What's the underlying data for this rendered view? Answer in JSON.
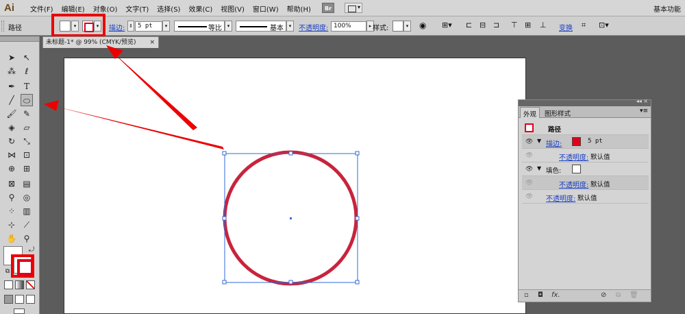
{
  "app": {
    "logo": "Ai",
    "menu": [
      "文件(F)",
      "编辑(E)",
      "对象(O)",
      "文字(T)",
      "选择(S)",
      "效果(C)",
      "视图(V)",
      "窗口(W)",
      "帮助(H)"
    ],
    "bridge_label": "Br",
    "workspace": "基本功能"
  },
  "control": {
    "selection_label": "路径",
    "stroke_label": "描边:",
    "stroke_weight": "5 pt",
    "profile_label": "等比",
    "brush_label": "基本",
    "opacity_label": "不透明度:",
    "opacity_value": "100%",
    "style_label": "样式:",
    "transform_label": "变换"
  },
  "document": {
    "tab_title": "未标题-1* @ 99% (CMYK/预览)",
    "close_glyph": "×"
  },
  "appearance_panel": {
    "tabs": [
      "外观",
      "图形样式"
    ],
    "header": "路径",
    "rows": [
      {
        "link": "描边:",
        "value": "5 pt"
      },
      {
        "link": "不透明度:",
        "value": "默认值"
      },
      {
        "label": "填色:"
      },
      {
        "link": "不透明度:",
        "value": "默认值"
      },
      {
        "link": "不透明度:",
        "value": "默认值"
      }
    ],
    "fx_label": "fx."
  },
  "colors": {
    "stroke": "#e0001a",
    "circle_stroke": "#c8243c",
    "highlight": "#ec0000",
    "selection": "#2f6ad9"
  },
  "icons": {
    "eye": "eye-icon",
    "selection_tool": "arrow-icon",
    "ellipse_tool": "ellipse-icon",
    "type_tool": "type-icon",
    "pen_tool": "pen-icon"
  }
}
